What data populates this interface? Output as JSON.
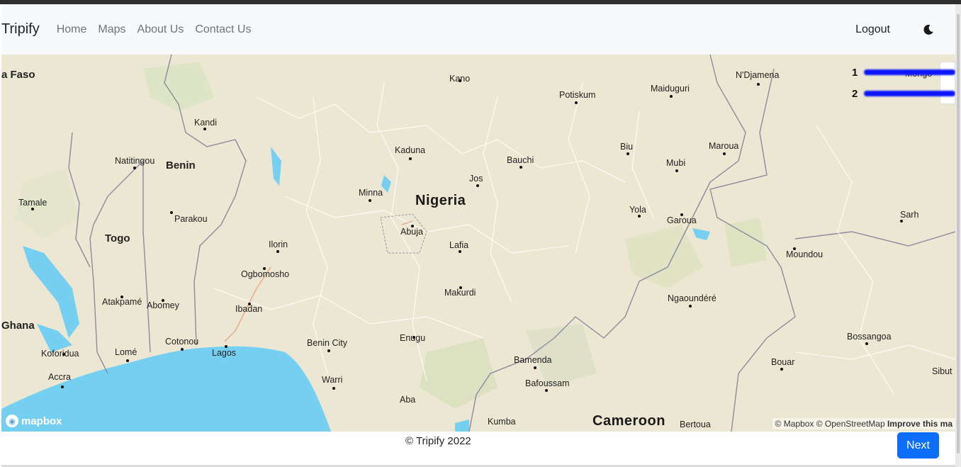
{
  "navbar": {
    "brand": "Tripify",
    "links": [
      "Home",
      "Maps",
      "About Us",
      "Contact Us"
    ],
    "logout": "Logout",
    "theme_icon": "moon-icon"
  },
  "map": {
    "countries": [
      "a Faso",
      "Benin",
      "Togo",
      "Ghana",
      "Nigeria",
      "Cameroon"
    ],
    "cities": [
      "Kano",
      "N'Djamena",
      "Mongo",
      "Potiskum",
      "Maiduguri",
      "Kandi",
      "Natitingou",
      "Kaduna",
      "Bauchi",
      "Biu",
      "Maroua",
      "Mubi",
      "Jos",
      "Minna",
      "Tamale",
      "Parakou",
      "Abuja",
      "Lafia",
      "Yola",
      "Garoua",
      "Sarh",
      "Ilorin",
      "Ogbomosho",
      "Moundou",
      "Atakpamé",
      "Abomey",
      "Makurdi",
      "Ngaoundéré",
      "Ibadan",
      "Cotonou",
      "Lagos",
      "Benin City",
      "Enugu",
      "Bossangoa",
      "Koforidua",
      "Lomé",
      "Bamenda",
      "Bouar",
      "Accra",
      "Warri",
      "Bafoussam",
      "Sibut",
      "Aba",
      "Kumba",
      "Bertoua"
    ],
    "logo": "mapbox",
    "attribution": "© Mapbox © OpenStreetMap",
    "improve": "Improve this ma"
  },
  "routes": [
    {
      "number": "1",
      "color": "#0a14ff"
    },
    {
      "number": "2",
      "color": "#0a14ff"
    }
  ],
  "footer": {
    "copyright": "© Tripify 2022",
    "next_label": "Next"
  },
  "colors": {
    "land": "#ece7d3",
    "water": "#75cff0",
    "primary": "#0d6efd"
  }
}
